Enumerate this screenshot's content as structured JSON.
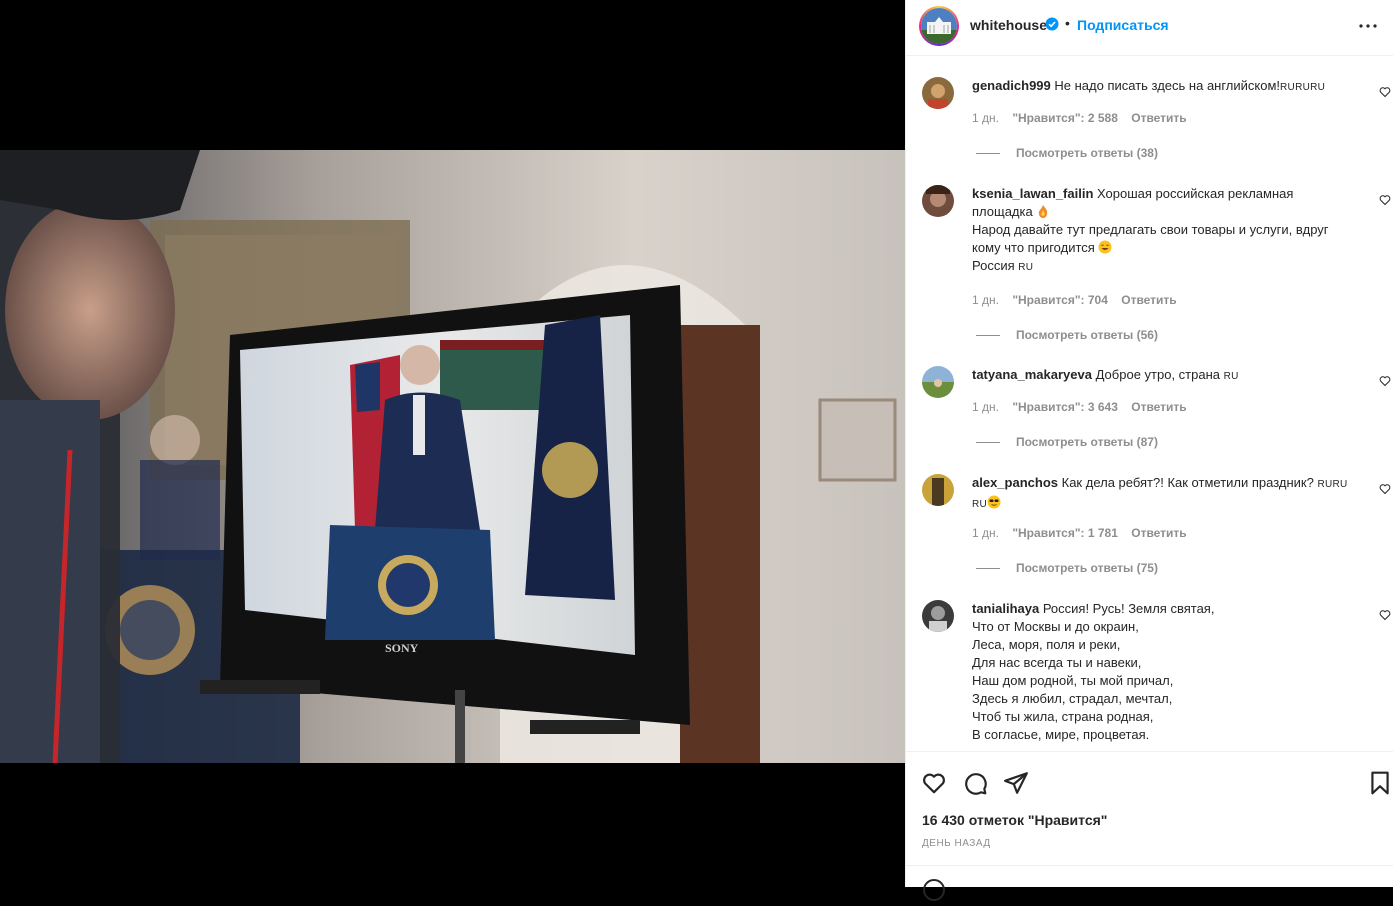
{
  "header": {
    "username": "whitehouse",
    "dot": "•",
    "follow_label": "Подписаться"
  },
  "comments": [
    {
      "username": "genadich999",
      "lines": [
        "Не надо писать здесь на английском!RURURU"
      ],
      "age": "1 дн.",
      "likes": "\"Нравится\": 2 588",
      "reply": "Ответить",
      "view_replies": "Посмотреть ответы (38)"
    },
    {
      "username": "ksenia_lawan_failin",
      "lines": [
        "Хорошая российская рекламная",
        "площадка",
        "Народ давайте тут предлагать свои товары и услуги, вдруг",
        "кому что пригодится",
        "Россия RU"
      ],
      "age": "1 дн.",
      "likes": "\"Нравится\": 704",
      "reply": "Ответить",
      "view_replies": "Посмотреть ответы (56)"
    },
    {
      "username": "tatyana_makaryeva",
      "lines": [
        "Доброе утро, страна RU"
      ],
      "age": "1 дн.",
      "likes": "\"Нравится\": 3 643",
      "reply": "Ответить",
      "view_replies": "Посмотреть ответы (87)"
    },
    {
      "username": "alex_panchos",
      "lines": [
        "Как дела ребят?! Как отметили праздник? RURU",
        "RU"
      ],
      "age": "1 дн.",
      "likes": "\"Нравится\": 1 781",
      "reply": "Ответить",
      "view_replies": "Посмотреть ответы (75)"
    },
    {
      "username": "tanialihaya",
      "lines": [
        "Россия! Русь! Земля святая,",
        "Что от Москвы и до окраин,",
        "Леса, моря, поля и реки,",
        "Для нас всегда ты и навеки,",
        "Наш дом родной, ты мой причал,",
        "Здесь я любил, страдал, мечтал,",
        "Чтоб ты жила, страна родная,",
        "В согласье, мире, процветая."
      ]
    }
  ],
  "footer": {
    "likes_count": "16 430 отметок \"Нравится\"",
    "time": "День назад"
  },
  "colors": {
    "accent": "#0095f6",
    "muted": "#8e8e8e",
    "text": "#262626"
  },
  "icons": [
    "verified-badge-icon",
    "more-options-icon",
    "heart-icon",
    "comment-icon",
    "share-icon",
    "bookmark-icon",
    "smile-icon"
  ]
}
